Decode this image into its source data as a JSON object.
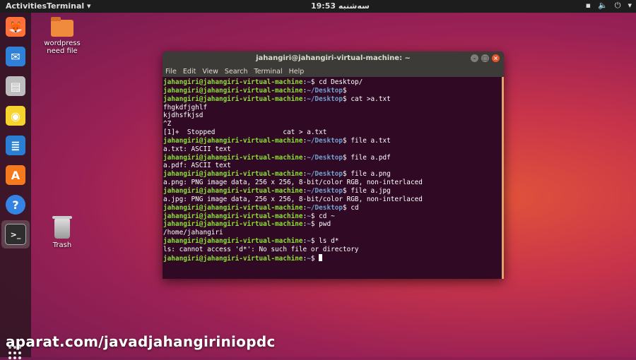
{
  "topbar": {
    "activities": "Activities",
    "app_menu": "Terminal ▾",
    "clock": "19:53 سه‌شنبه",
    "tray": [
      "▪",
      "🔈",
      "⏻",
      "▾"
    ]
  },
  "dock": {
    "items": [
      {
        "name": "firefox",
        "glyph": "🦊",
        "color": "#ff7139"
      },
      {
        "name": "thunderbird",
        "glyph": "✉",
        "color": "#2f80d8"
      },
      {
        "name": "files",
        "glyph": "▤",
        "color": "#bdbdbd"
      },
      {
        "name": "rhythmbox",
        "glyph": "◉",
        "color": "#f6d32d"
      },
      {
        "name": "writer",
        "glyph": "≣",
        "color": "#2a7fd4"
      },
      {
        "name": "software",
        "glyph": "A",
        "color": "#f57a1e"
      },
      {
        "name": "help",
        "glyph": "?",
        "color": "#3584e4"
      },
      {
        "name": "terminal",
        "glyph": ">_",
        "color": "#2e2e2e"
      }
    ]
  },
  "desktop": {
    "folder_label_1": "wordpress",
    "folder_label_2": "need file",
    "trash_label": "Trash"
  },
  "terminal": {
    "title": "jahangiri@jahangiri-virtual-machine: ~",
    "menu": [
      "File",
      "Edit",
      "View",
      "Search",
      "Terminal",
      "Help"
    ],
    "lines": [
      {
        "user": "jahangiri@jahangiri-virtual-machine",
        "path": "~",
        "cmd": "$ cd Desktop/"
      },
      {
        "user": "jahangiri@jahangiri-virtual-machine",
        "path": "~/Desktop",
        "cmd": "$"
      },
      {
        "user": "jahangiri@jahangiri-virtual-machine",
        "path": "~/Desktop",
        "cmd": "$ cat >a.txt"
      },
      {
        "out": "fhgkdfjghlf"
      },
      {
        "out": "kjdhsfkjsd"
      },
      {
        "out": "^Z"
      },
      {
        "out": "[1]+  Stopped                 cat > a.txt"
      },
      {
        "user": "jahangiri@jahangiri-virtual-machine",
        "path": "~/Desktop",
        "cmd": "$ file a.txt"
      },
      {
        "out": "a.txt: ASCII text"
      },
      {
        "user": "jahangiri@jahangiri-virtual-machine",
        "path": "~/Desktop",
        "cmd": "$ file a.pdf"
      },
      {
        "out": "a.pdf: ASCII text"
      },
      {
        "user": "jahangiri@jahangiri-virtual-machine",
        "path": "~/Desktop",
        "cmd": "$ file a.png"
      },
      {
        "out": "a.png: PNG image data, 256 x 256, 8-bit/color RGB, non-interlaced"
      },
      {
        "user": "jahangiri@jahangiri-virtual-machine",
        "path": "~/Desktop",
        "cmd": "$ file a.jpg"
      },
      {
        "out": "a.jpg: PNG image data, 256 x 256, 8-bit/color RGB, non-interlaced"
      },
      {
        "user": "jahangiri@jahangiri-virtual-machine",
        "path": "~/Desktop",
        "cmd": "$ cd"
      },
      {
        "user": "jahangiri@jahangiri-virtual-machine",
        "path": "~",
        "cmd": "$ cd ~"
      },
      {
        "user": "jahangiri@jahangiri-virtual-machine",
        "path": "~",
        "cmd": "$ pwd"
      },
      {
        "out": "/home/jahangiri"
      },
      {
        "user": "jahangiri@jahangiri-virtual-machine",
        "path": "~",
        "cmd": "$ ls d*"
      },
      {
        "out": "ls: cannot access 'd*': No such file or directory"
      },
      {
        "user": "jahangiri@jahangiri-virtual-machine",
        "path": "~",
        "cmd": "$ ",
        "cursor": true
      }
    ]
  },
  "watermark": "aparat.com/javadjahangiriniopdc",
  "colors": {
    "prompt_user": "#8ae234",
    "prompt_path": "#729fcf",
    "terminal_bg": "#300a24"
  }
}
